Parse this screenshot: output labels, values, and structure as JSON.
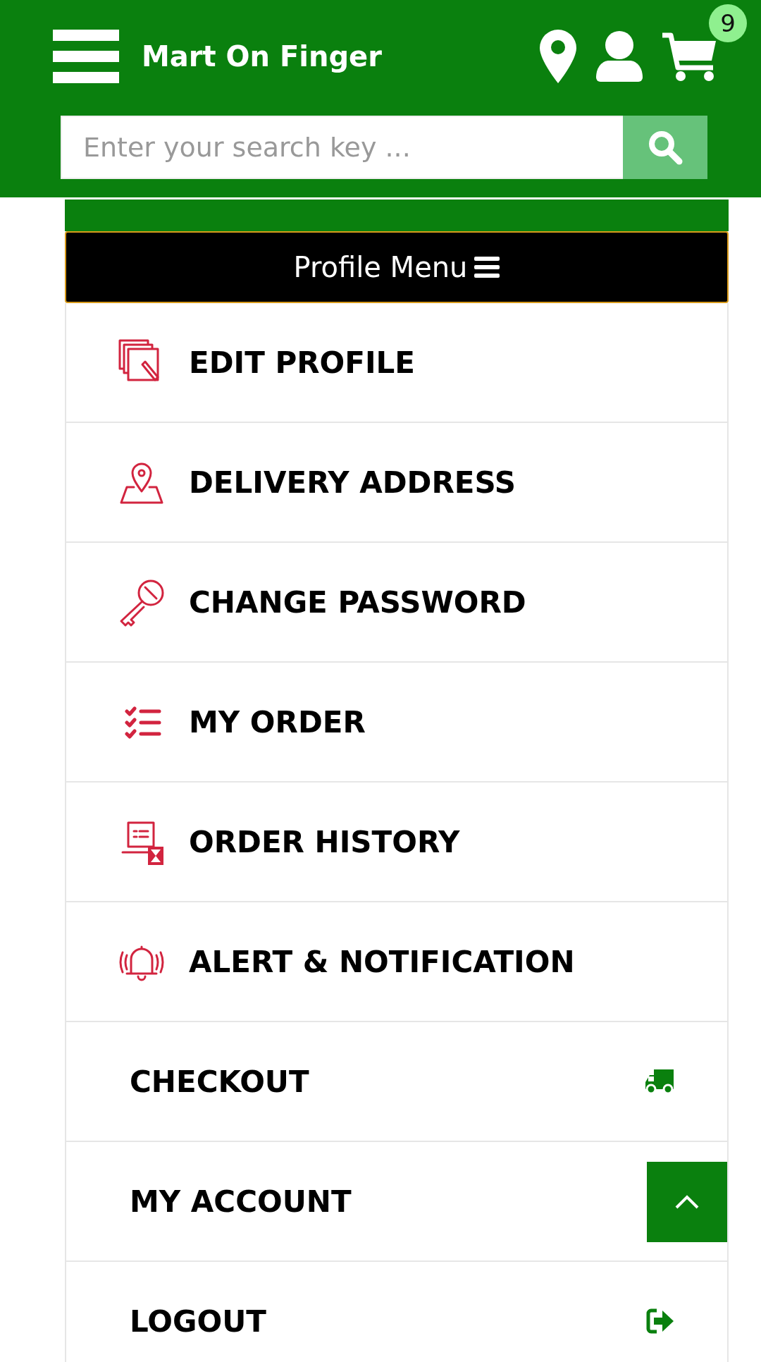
{
  "header": {
    "title": "Mart On Finger",
    "cart_count": "9",
    "search": {
      "placeholder": "Enter your search key ..."
    }
  },
  "profile_menu": {
    "label": "Profile Menu"
  },
  "menu_items": [
    {
      "label": "EDIT PROFILE",
      "kind": "leading"
    },
    {
      "label": "DELIVERY ADDRESS",
      "kind": "leading"
    },
    {
      "label": "CHANGE PASSWORD",
      "kind": "leading"
    },
    {
      "label": "MY ORDER",
      "kind": "leading"
    },
    {
      "label": "ORDER HISTORY",
      "kind": "leading"
    },
    {
      "label": "ALERT & NOTIFICATION",
      "kind": "leading"
    },
    {
      "label": "CHECKOUT",
      "kind": "trailing"
    },
    {
      "label": "MY ACCOUNT",
      "kind": "trailing"
    },
    {
      "label": "LOGOUT",
      "kind": "trailing"
    }
  ]
}
